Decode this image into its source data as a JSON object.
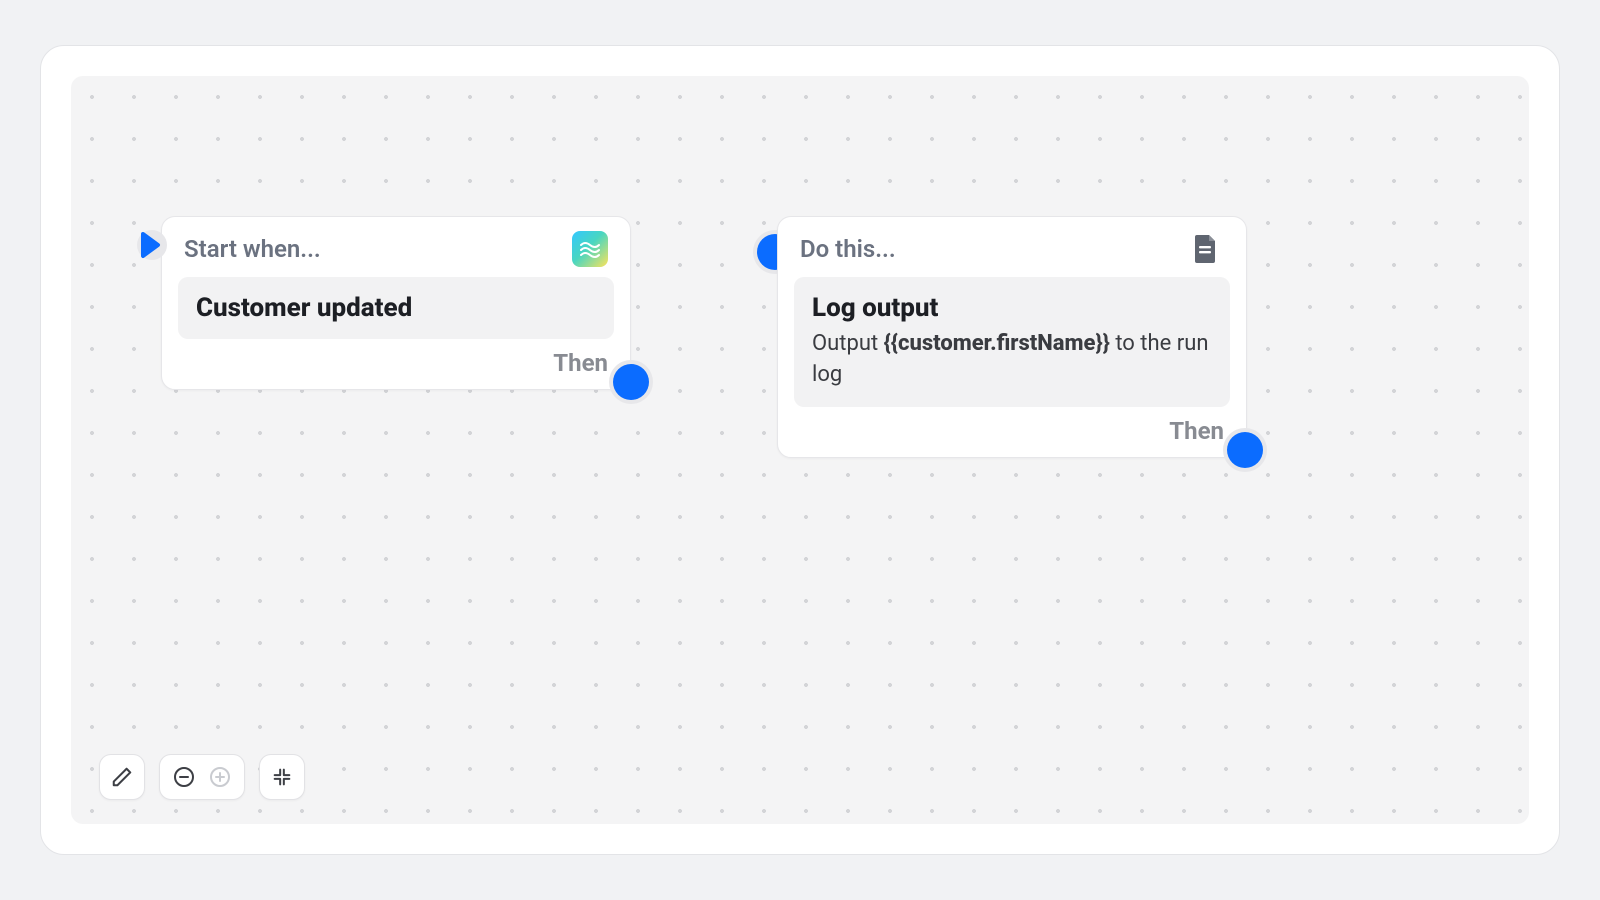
{
  "nodes": {
    "trigger": {
      "head": "Start when...",
      "title": "Customer updated",
      "then": "Then"
    },
    "action": {
      "head": "Do this...",
      "title": "Log output",
      "desc_prefix": "Output ",
      "desc_variable": "{{customer.firstName}}",
      "desc_suffix": " to the run log",
      "then": "Then"
    }
  },
  "colors": {
    "accent": "#0b6cff"
  }
}
